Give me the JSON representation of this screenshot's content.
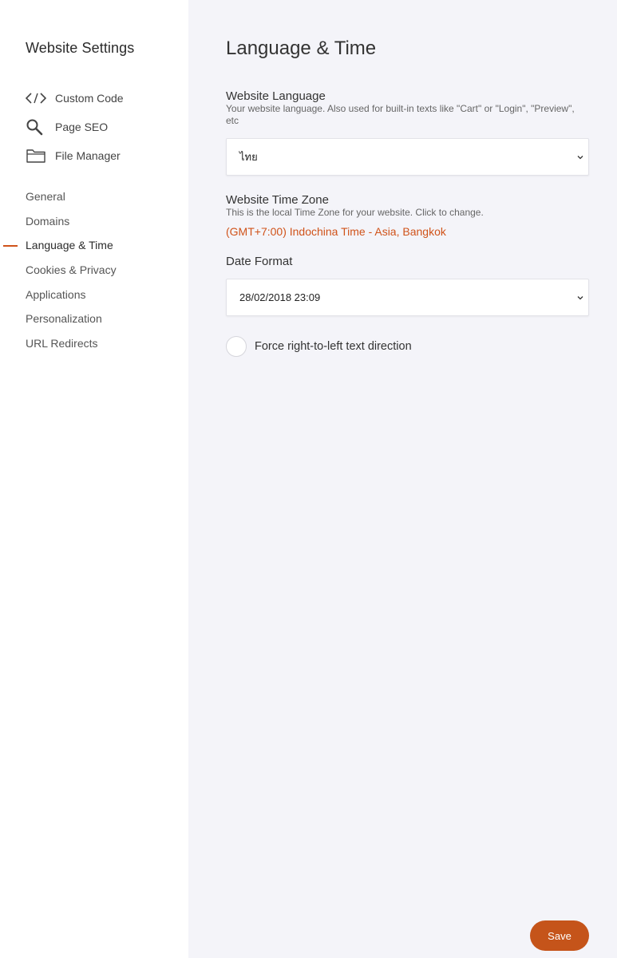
{
  "sidebar": {
    "title": "Website Settings",
    "tools": [
      {
        "label": "Custom Code",
        "icon": "code-icon"
      },
      {
        "label": "Page SEO",
        "icon": "search-icon"
      },
      {
        "label": "File Manager",
        "icon": "folder-icon"
      }
    ],
    "nav": [
      {
        "label": "General"
      },
      {
        "label": "Domains"
      },
      {
        "label": "Language & Time",
        "active": true
      },
      {
        "label": "Cookies & Privacy"
      },
      {
        "label": "Applications"
      },
      {
        "label": "Personalization"
      },
      {
        "label": "URL Redirects"
      }
    ]
  },
  "main": {
    "title": "Language & Time",
    "language": {
      "label": "Website Language",
      "description": "Your website language. Also used for built-in texts like \"Cart\" or \"Login\", \"Preview\", etc",
      "value": "ไทย"
    },
    "timezone": {
      "label": "Website Time Zone",
      "description": "This is the local Time Zone for your website. Click to change.",
      "value": "(GMT+7:00) Indochina Time - Asia, Bangkok"
    },
    "date_format": {
      "label": "Date Format",
      "value": "28/02/2018 23:09"
    },
    "rtl": {
      "label": "Force right-to-left text direction",
      "checked": false
    }
  },
  "footer": {
    "save_label": "Save"
  },
  "colors": {
    "accent": "#d0531a",
    "save_button": "#c5541a",
    "sidebar_bg": "#ffffff",
    "main_bg": "#f4f4f9"
  }
}
